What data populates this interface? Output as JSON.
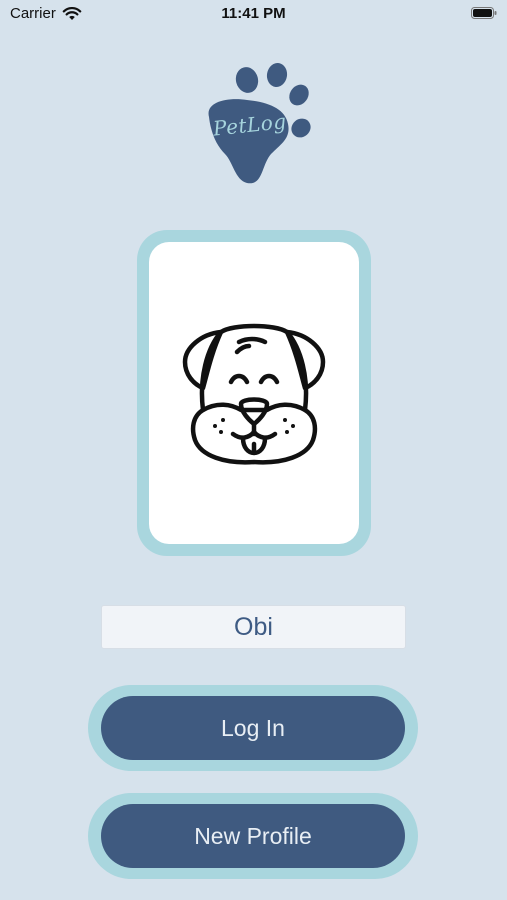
{
  "status_bar": {
    "carrier": "Carrier",
    "time": "11:41 PM"
  },
  "app": {
    "logo_text": "PetLog",
    "brand_color": "#3f5a80",
    "accent_color": "#a9d6de"
  },
  "pet": {
    "icon": "dog-face-icon",
    "name": "Obi"
  },
  "buttons": {
    "login_label": "Log In",
    "new_profile_label": "New Profile"
  }
}
